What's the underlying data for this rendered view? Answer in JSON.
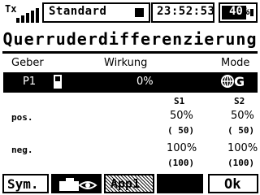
{
  "status": {
    "tx_label": "Tx",
    "model": "Standard",
    "time": "23:52:53",
    "battery_text": "40",
    "battery_pct_sign": "%",
    "battery_level": 0.4
  },
  "title": "Querruderdifferenzierung",
  "headers": {
    "geber": "Geber",
    "wirkung": "Wirkung",
    "mode": "Mode"
  },
  "selected_row": {
    "geber": "P1",
    "wirkung": "0%",
    "mode": "G"
  },
  "columns": {
    "s1": "S1",
    "s2": "S2"
  },
  "rows": [
    {
      "label": "pos.",
      "s1_value": "50%",
      "s1_raw": "( 50)",
      "s2_value": "50%",
      "s2_raw": "( 50)"
    },
    {
      "label": "neg.",
      "s1_value": "100%",
      "s1_raw": "(100)",
      "s2_value": "100%",
      "s2_raw": "(100)"
    }
  ],
  "buttons": {
    "sym": "Sym.",
    "app": "App1",
    "ok": "Ok"
  },
  "icons": {
    "signal": "signal-strength-icon",
    "switch": "switch-icon",
    "globe": "globe-icon",
    "camera": "camera-view-icon"
  }
}
